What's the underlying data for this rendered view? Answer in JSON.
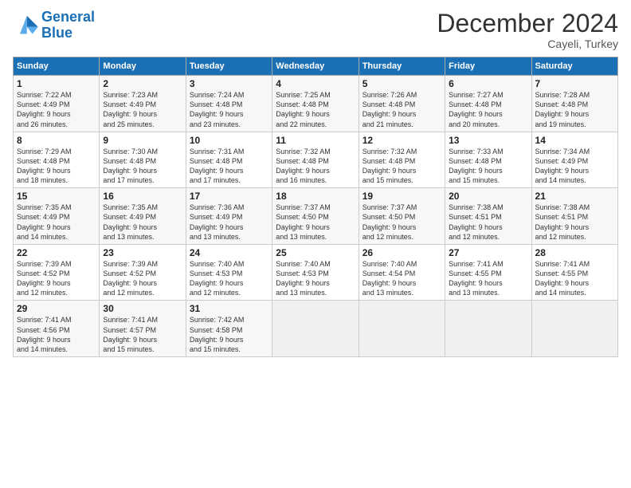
{
  "logo": {
    "line1": "General",
    "line2": "Blue"
  },
  "title": "December 2024",
  "subtitle": "Cayeli, Turkey",
  "header_days": [
    "Sunday",
    "Monday",
    "Tuesday",
    "Wednesday",
    "Thursday",
    "Friday",
    "Saturday"
  ],
  "weeks": [
    [
      {
        "day": "1",
        "info": "Sunrise: 7:22 AM\nSunset: 4:49 PM\nDaylight: 9 hours\nand 26 minutes."
      },
      {
        "day": "2",
        "info": "Sunrise: 7:23 AM\nSunset: 4:49 PM\nDaylight: 9 hours\nand 25 minutes."
      },
      {
        "day": "3",
        "info": "Sunrise: 7:24 AM\nSunset: 4:48 PM\nDaylight: 9 hours\nand 23 minutes."
      },
      {
        "day": "4",
        "info": "Sunrise: 7:25 AM\nSunset: 4:48 PM\nDaylight: 9 hours\nand 22 minutes."
      },
      {
        "day": "5",
        "info": "Sunrise: 7:26 AM\nSunset: 4:48 PM\nDaylight: 9 hours\nand 21 minutes."
      },
      {
        "day": "6",
        "info": "Sunrise: 7:27 AM\nSunset: 4:48 PM\nDaylight: 9 hours\nand 20 minutes."
      },
      {
        "day": "7",
        "info": "Sunrise: 7:28 AM\nSunset: 4:48 PM\nDaylight: 9 hours\nand 19 minutes."
      }
    ],
    [
      {
        "day": "8",
        "info": "Sunrise: 7:29 AM\nSunset: 4:48 PM\nDaylight: 9 hours\nand 18 minutes."
      },
      {
        "day": "9",
        "info": "Sunrise: 7:30 AM\nSunset: 4:48 PM\nDaylight: 9 hours\nand 17 minutes."
      },
      {
        "day": "10",
        "info": "Sunrise: 7:31 AM\nSunset: 4:48 PM\nDaylight: 9 hours\nand 17 minutes."
      },
      {
        "day": "11",
        "info": "Sunrise: 7:32 AM\nSunset: 4:48 PM\nDaylight: 9 hours\nand 16 minutes."
      },
      {
        "day": "12",
        "info": "Sunrise: 7:32 AM\nSunset: 4:48 PM\nDaylight: 9 hours\nand 15 minutes."
      },
      {
        "day": "13",
        "info": "Sunrise: 7:33 AM\nSunset: 4:48 PM\nDaylight: 9 hours\nand 15 minutes."
      },
      {
        "day": "14",
        "info": "Sunrise: 7:34 AM\nSunset: 4:49 PM\nDaylight: 9 hours\nand 14 minutes."
      }
    ],
    [
      {
        "day": "15",
        "info": "Sunrise: 7:35 AM\nSunset: 4:49 PM\nDaylight: 9 hours\nand 14 minutes."
      },
      {
        "day": "16",
        "info": "Sunrise: 7:35 AM\nSunset: 4:49 PM\nDaylight: 9 hours\nand 13 minutes."
      },
      {
        "day": "17",
        "info": "Sunrise: 7:36 AM\nSunset: 4:49 PM\nDaylight: 9 hours\nand 13 minutes."
      },
      {
        "day": "18",
        "info": "Sunrise: 7:37 AM\nSunset: 4:50 PM\nDaylight: 9 hours\nand 13 minutes."
      },
      {
        "day": "19",
        "info": "Sunrise: 7:37 AM\nSunset: 4:50 PM\nDaylight: 9 hours\nand 12 minutes."
      },
      {
        "day": "20",
        "info": "Sunrise: 7:38 AM\nSunset: 4:51 PM\nDaylight: 9 hours\nand 12 minutes."
      },
      {
        "day": "21",
        "info": "Sunrise: 7:38 AM\nSunset: 4:51 PM\nDaylight: 9 hours\nand 12 minutes."
      }
    ],
    [
      {
        "day": "22",
        "info": "Sunrise: 7:39 AM\nSunset: 4:52 PM\nDaylight: 9 hours\nand 12 minutes."
      },
      {
        "day": "23",
        "info": "Sunrise: 7:39 AM\nSunset: 4:52 PM\nDaylight: 9 hours\nand 12 minutes."
      },
      {
        "day": "24",
        "info": "Sunrise: 7:40 AM\nSunset: 4:53 PM\nDaylight: 9 hours\nand 12 minutes."
      },
      {
        "day": "25",
        "info": "Sunrise: 7:40 AM\nSunset: 4:53 PM\nDaylight: 9 hours\nand 13 minutes."
      },
      {
        "day": "26",
        "info": "Sunrise: 7:40 AM\nSunset: 4:54 PM\nDaylight: 9 hours\nand 13 minutes."
      },
      {
        "day": "27",
        "info": "Sunrise: 7:41 AM\nSunset: 4:55 PM\nDaylight: 9 hours\nand 13 minutes."
      },
      {
        "day": "28",
        "info": "Sunrise: 7:41 AM\nSunset: 4:55 PM\nDaylight: 9 hours\nand 14 minutes."
      }
    ],
    [
      {
        "day": "29",
        "info": "Sunrise: 7:41 AM\nSunset: 4:56 PM\nDaylight: 9 hours\nand 14 minutes."
      },
      {
        "day": "30",
        "info": "Sunrise: 7:41 AM\nSunset: 4:57 PM\nDaylight: 9 hours\nand 15 minutes."
      },
      {
        "day": "31",
        "info": "Sunrise: 7:42 AM\nSunset: 4:58 PM\nDaylight: 9 hours\nand 15 minutes."
      },
      null,
      null,
      null,
      null
    ]
  ]
}
